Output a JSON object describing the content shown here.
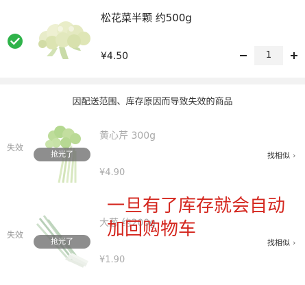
{
  "active_item": {
    "title": "松花菜半颗 约500g",
    "price": "¥4.50",
    "quantity": "1",
    "selected": true
  },
  "invalid_section": {
    "header": "因配送范围、库存原因而导致失效的商品",
    "items": [
      {
        "status": "失效",
        "badge": "抢光了",
        "title": "黄心芹 300g",
        "price": "¥4.90",
        "action": "找相似"
      },
      {
        "status": "失效",
        "badge": "抢光了",
        "title": "大葱 约200g",
        "price": "¥1.90",
        "action": "找相似"
      }
    ]
  },
  "annotation": {
    "line1": "一旦有了库存就会自动",
    "line2": "加回购物车"
  },
  "colors": {
    "check_green": "#2fb34a",
    "annotation_red": "#d4261e",
    "dim_text": "#a9a9a9"
  }
}
